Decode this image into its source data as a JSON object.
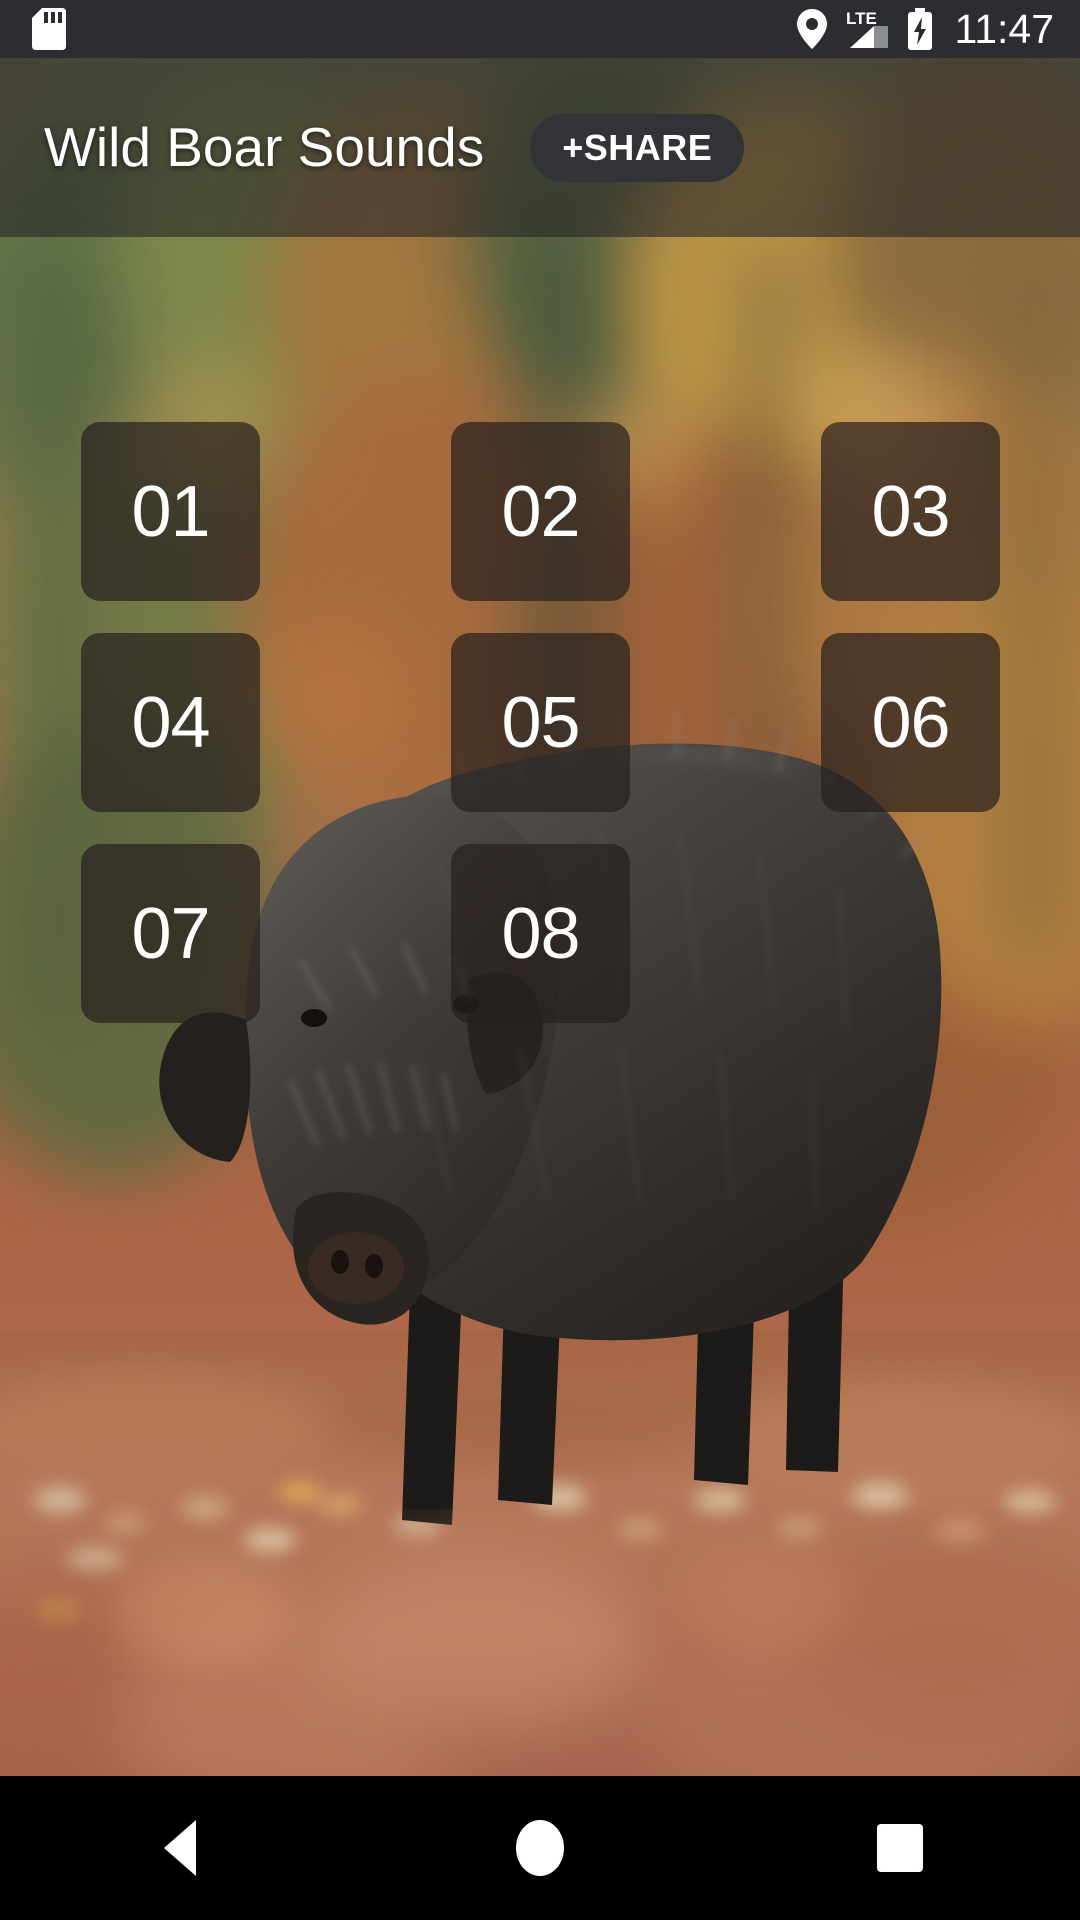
{
  "status_bar": {
    "sd_card_icon": "sd-card-icon",
    "location_icon": "location-pin-icon",
    "network_label": "LTE",
    "signal_icon": "signal-bars-icon",
    "battery_icon": "battery-charging-icon",
    "time": "11:47",
    "background_color": "#2b2d30"
  },
  "app_bar": {
    "title": "Wild Boar Sounds",
    "share_label": "+SHARE",
    "share_button_color": "#313337",
    "background_color": "rgba(40,40,40,0.62)"
  },
  "grid": {
    "tiles": [
      {
        "label": "01"
      },
      {
        "label": "02"
      },
      {
        "label": "03"
      },
      {
        "label": "04"
      },
      {
        "label": "05"
      },
      {
        "label": "06"
      },
      {
        "label": "07"
      },
      {
        "label": "08"
      }
    ],
    "tile_color": "rgba(38,32,30,0.70)",
    "label_color": "#ffffff"
  },
  "wallpaper": {
    "description": "wild-boar-autumn-forest-photo",
    "palette": {
      "canopy_green": "#6d7a4e",
      "canopy_orange": "#b2743c",
      "canopy_yellow": "#c6a24a",
      "canopy_rust": "#9a5f37",
      "ground_rust": "#a8603c",
      "ground_light": "#c99176",
      "boar_dark": "#2a2724",
      "boar_mid": "#4a4640",
      "boar_light": "#7d7870"
    }
  },
  "nav_bar": {
    "back_icon": "back-triangle-icon",
    "home_icon": "home-circle-icon",
    "recents_icon": "recents-square-icon",
    "background_color": "#000000"
  }
}
